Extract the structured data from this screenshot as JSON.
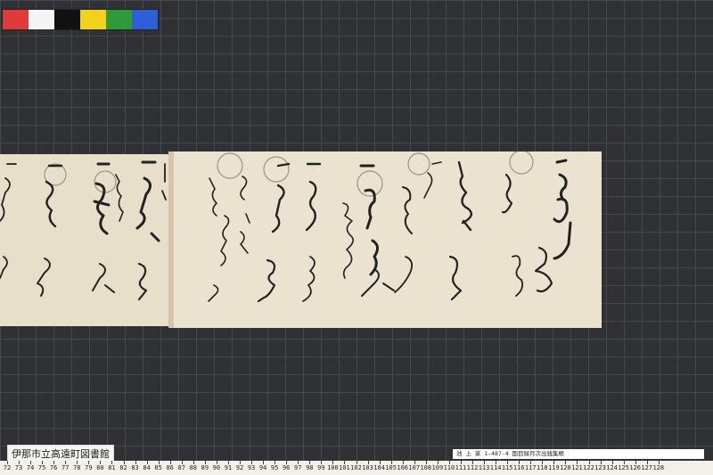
{
  "photo": {
    "subject": "",
    "color_chart": [
      "#e03a3a",
      "#f5f5f5",
      "#111111",
      "#f2d21c",
      "#2e9a3a",
      "#2f5fd8"
    ]
  },
  "labels": {
    "library": "伊那市立高遠町図書館",
    "code": "池 上 家   1-487-4 国目録月次出銭集帳"
  },
  "ruler": {
    "numbers": [
      "72",
      "73",
      "74",
      "75",
      "76",
      "77",
      "78",
      "79",
      "80",
      "81",
      "82",
      "83",
      "84",
      "85",
      "86",
      "87",
      "88",
      "89",
      "90",
      "91",
      "92",
      "93",
      "94",
      "95",
      "96",
      "97",
      "98",
      "99",
      "100",
      "101",
      "102",
      "103",
      "104",
      "105",
      "106",
      "107",
      "108",
      "109",
      "110",
      "111",
      "112",
      "113",
      "114",
      "115",
      "116",
      "117",
      "118",
      "119",
      "120",
      "121",
      "122",
      "123",
      "124",
      "125",
      "126",
      "127",
      "128"
    ]
  }
}
